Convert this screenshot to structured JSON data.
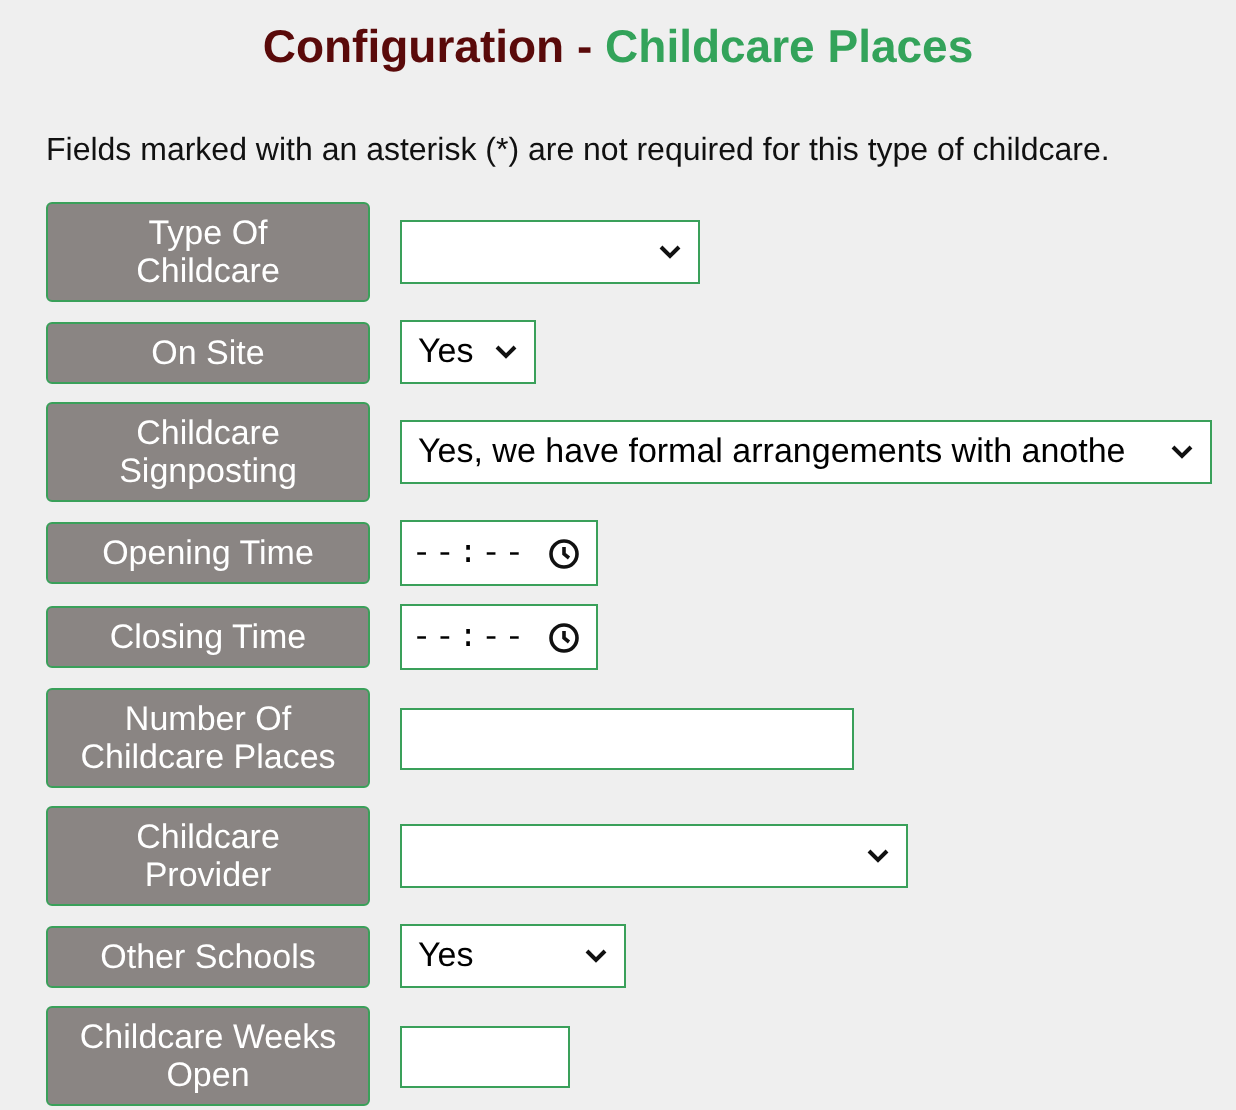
{
  "title": {
    "prefix": "Configuration -",
    "highlight": "Childcare Places"
  },
  "note": "Fields marked with an asterisk (*) are not required for this type of childcare.",
  "fields": [
    {
      "label": "Type Of Childcare",
      "kind": "select"
    },
    {
      "label": "On Site",
      "kind": "select",
      "value": "Yes"
    },
    {
      "label": "Childcare Signposting",
      "kind": "select",
      "value": "Yes, we have formal arrangements with anothe"
    },
    {
      "label": "Opening Time",
      "kind": "time",
      "value": "--:--"
    },
    {
      "label": "Closing Time",
      "kind": "time",
      "value": "--:--"
    },
    {
      "label": "Number Of Childcare Places",
      "kind": "text"
    },
    {
      "label": "Childcare Provider",
      "kind": "select"
    },
    {
      "label": "Other Schools",
      "kind": "select",
      "value": "Yes"
    },
    {
      "label": "Childcare Weeks Open",
      "kind": "text"
    }
  ]
}
